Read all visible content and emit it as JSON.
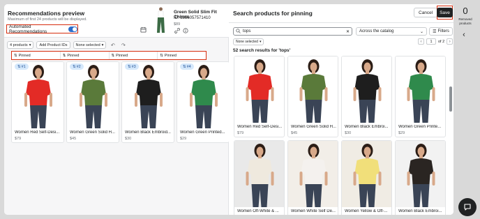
{
  "left_panel": {
    "title": "Recommendations preview",
    "subtitle": "Maximum of first 24 products will be displayed.",
    "auto_recs_label": "Automated Recommendations",
    "auto_recs_on": true
  },
  "product": {
    "name": "Green Solid Slim Fit Chinos",
    "id": "ID: 3956057571410",
    "price": "$89"
  },
  "toolbar": {
    "products_count": "4 products",
    "add_ids": "Add Product IDs",
    "none_selected": "None selected"
  },
  "pinned_label": "Pinned",
  "preview_cards": [
    {
      "rank": "#1",
      "name": "Women Red Self-Desi...",
      "price": "$79",
      "color": "#e32b26"
    },
    {
      "rank": "#2",
      "name": "Women Green Solid H...",
      "price": "$45",
      "color": "#5a7a3a"
    },
    {
      "rank": "#3",
      "name": "Women Black Embroid...",
      "price": "$30",
      "color": "#1e1e1e"
    },
    {
      "rank": "#4",
      "name": "Women Green Printed...",
      "price": "$29",
      "color": "#2f8a4c"
    }
  ],
  "right_panel": {
    "title": "Search products for pinning",
    "cancel": "Cancel",
    "save": "Save",
    "search_value": "tops",
    "scope": "Across the catalog",
    "filters": "Filters",
    "none_selected": "None selected",
    "page_current": "1",
    "page_total": "of 2",
    "results": "52 search results for 'tops'"
  },
  "search_results": [
    {
      "name": "Women Red Self-Desi...",
      "price": "$79",
      "color": "#e32b26",
      "bg": "#ffffff"
    },
    {
      "name": "Women Green Solid H...",
      "price": "$45",
      "color": "#5a7a3a",
      "bg": "#ffffff"
    },
    {
      "name": "Women Black Embroi...",
      "price": "$30",
      "color": "#1e1e1e",
      "bg": "#ffffff"
    },
    {
      "name": "Women Green Printe...",
      "price": "$29",
      "color": "#2f8a4c",
      "bg": "#ffffff"
    },
    {
      "name": "Women Off-White & ...",
      "price": "",
      "color": "#efe9de",
      "bg": "#e9e9e9"
    },
    {
      "name": "Women White Self De...",
      "price": "",
      "color": "#f4f1ee",
      "bg": "#f2eee8"
    },
    {
      "name": "Women Yellow & Off-...",
      "price": "",
      "color": "#f1df7a",
      "bg": "#f0ece4"
    },
    {
      "name": "Women Black Embroi...",
      "price": "",
      "color": "#2a2522",
      "bg": "#f2f2f2"
    }
  ],
  "side": {
    "removed_count": "0",
    "removed_label": "Removed products"
  }
}
